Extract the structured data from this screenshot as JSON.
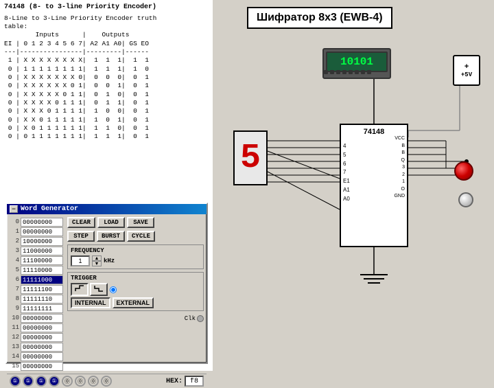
{
  "left_panel": {
    "title": "74148 (8- to 3-line Priority Encoder)",
    "description": "8-Line to 3-Line Priority Encoder truth table:",
    "truth_table": "        Inputs      |    Outputs\nEI | 0 1 2 3 4 5 6 7 | A2  A1  A0 | GS  EO\n---|----------------|-----------|--------\n 1 | X X X X X X X X |  1   1   1 |  1   1\n 0 | 1 1 1 1 1 1 1 1 |  1   1   1 |  1   0\n 0 | X X X X X X X 0 |  0   0   0 |  0   1\n 0 | X X X X X X 0 1 |  0   0   1 |  0   1\n 0 | X X X X X 0 1 1 |  0   1   0 |  0   1\n 0 | X X X X 0 1 1 1 |  0   1   1 |  0   1\n 0 | X X X 0 1 1 1 1 |  1   0   0 |  0   1\n 0 | X X 0 1 1 1 1 1 |  1   0   1 |  0   1\n 0 | X 0 1 1 1 1 1 1 |  1   1   0 |  0   1\n 0 | 0 1 1 1 1 1 1 1 |  1   1   1 |  0   1"
  },
  "word_generator": {
    "title": "Word Generator",
    "words": [
      {
        "index": 0,
        "value": "00000000"
      },
      {
        "index": 1,
        "value": "00000000"
      },
      {
        "index": 2,
        "value": "10000000"
      },
      {
        "index": 3,
        "value": "11000000"
      },
      {
        "index": 4,
        "value": "11100000"
      },
      {
        "index": 5,
        "value": "11110000"
      },
      {
        "index": 6,
        "value": "11111000",
        "selected": true
      },
      {
        "index": 7,
        "value": "11111100"
      },
      {
        "index": 8,
        "value": "11111110"
      },
      {
        "index": 9,
        "value": "11111111"
      },
      {
        "index": 10,
        "value": "00000000"
      },
      {
        "index": 11,
        "value": "00000000"
      },
      {
        "index": 12,
        "value": "00000000"
      },
      {
        "index": 13,
        "value": "00000000"
      },
      {
        "index": 14,
        "value": "00000000"
      },
      {
        "index": 15,
        "value": "00000000"
      }
    ],
    "buttons": {
      "clear": "CLEAR",
      "load": "LOAD",
      "save": "SAVE",
      "step": "STEP",
      "burst": "BURST",
      "cycle": "CYCLE"
    },
    "frequency": {
      "label": "FREQUENCY",
      "value": "1",
      "unit": "kHz"
    },
    "trigger": {
      "label": "TRIGGER",
      "internal_label": "INTERNAL",
      "external_label": "EXTERNAL"
    },
    "hex_label": "HEX:",
    "hex_value": "f8",
    "bottom_indicators": [
      "①",
      "①",
      "①",
      "①",
      "⓪",
      "⓪",
      "⓪",
      "⓪"
    ],
    "clk_label": "Clk"
  },
  "schematic": {
    "title": "Шифратор 8x3 (EWB-4)",
    "chip_name": "74148",
    "led_display_value": "10101",
    "seven_seg_value": "5",
    "power_label": "+5V",
    "chip_left_pins": [
      "4",
      "5",
      "6",
      "7",
      "E1",
      "A1",
      "A0"
    ],
    "chip_right_pins": [
      "VCC",
      "B",
      "B",
      "Q",
      "3",
      "2",
      "1",
      "O",
      "GND"
    ],
    "ground_symbol": "⏚"
  }
}
